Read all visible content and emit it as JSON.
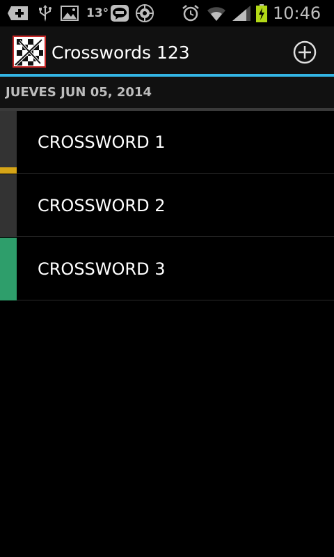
{
  "status_bar": {
    "temperature": "13°",
    "time": "10:46",
    "left_icons": [
      "add-icon",
      "usb-icon",
      "image-icon",
      "line-app-icon",
      "aperture-icon"
    ],
    "right_icons": [
      "alarm-icon",
      "wifi-icon",
      "signal-icon",
      "battery-charging-icon"
    ]
  },
  "action_bar": {
    "title": "Crosswords 123",
    "action_icon": "add-circle-icon",
    "accent_color": "#33b5e5"
  },
  "section": {
    "title": "JUEVES JUN 05, 2014"
  },
  "crosswords": [
    {
      "label": "CROSSWORD 1",
      "progress": 0.1,
      "progress_color": "#d6a517"
    },
    {
      "label": "CROSSWORD 2",
      "progress": 0,
      "progress_color": "#d6a517"
    },
    {
      "label": "CROSSWORD 3",
      "progress": 1,
      "progress_color": "#2e9e6b"
    }
  ]
}
